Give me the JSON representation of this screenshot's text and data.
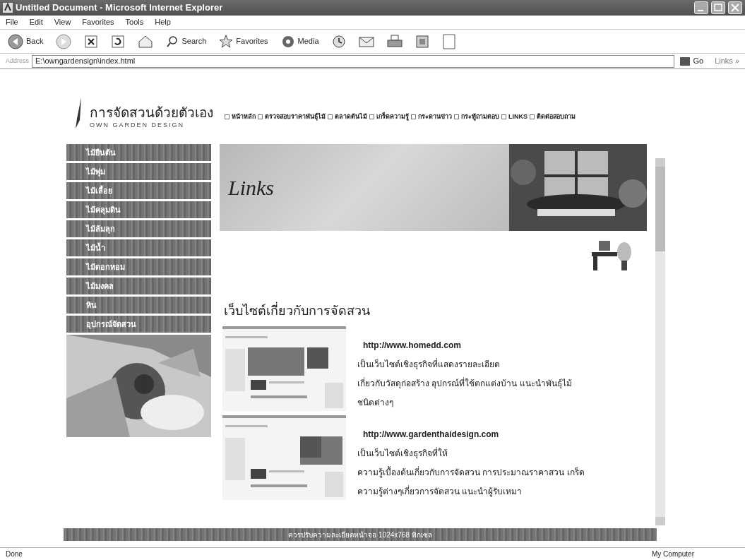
{
  "window": {
    "title": "Untitled Document - Microsoft Internet Explorer"
  },
  "menu": [
    "File",
    "Edit",
    "View",
    "Favorites",
    "Tools",
    "Help"
  ],
  "toolbar": [
    {
      "kind": "back",
      "label": "Back"
    },
    {
      "kind": "forward"
    },
    {
      "kind": "stop"
    },
    {
      "kind": "refresh"
    },
    {
      "kind": "home"
    },
    {
      "kind": "search",
      "label": "Search"
    },
    {
      "kind": "favorites",
      "label": "Favorites"
    },
    {
      "kind": "media",
      "label": "Media"
    },
    {
      "kind": "history"
    },
    {
      "kind": "mail"
    },
    {
      "kind": "print"
    },
    {
      "kind": "edit"
    },
    {
      "kind": "note"
    }
  ],
  "address_bar": {
    "label": "Address",
    "value": "E:\\owngardensign\\index.html",
    "go": "Go",
    "links": "Links »"
  },
  "site": {
    "logo_title": "การจัดสวนด้วยตัวเอง",
    "logo_subtitle": "OWN GARDEN DESIGN",
    "nav": [
      "หน้าหลัก",
      "ตรวจสอบราคาพันธุ์ไม้",
      "ตลาดต้นไม้",
      "เกร็ดความรู้",
      "กระดานข่าว",
      "กระทู้ถามตอบ",
      "LINKS",
      "ติดต่อสอบถาม"
    ],
    "sidebar": [
      "ไม้ยืนต้น",
      "ไม้พุ่ม",
      "ไม้เลื้อย",
      "ไม้คลุมดิน",
      "ไม้ล้มลุก",
      "ไม้น้ำ",
      "ไม้ดอกหอม",
      "ไม้มงคล",
      "หิน",
      "อุปกรณ์จัดสวน"
    ],
    "banner_title": "Links",
    "heading": "เว็บไซต์เกี่ยวกับการจัดสวน",
    "entries": [
      {
        "url": "http://www.homedd.com",
        "lines": [
          "เป็นเว็บไซต์เชิงธุรกิจที่แสดงรายละเอียด",
          "เกี่ยวกับวัสดุก่อสร้าง อุปกรณ์ที่ใช้ตกแต่งบ้าน แนะนำพันธุ์ไม้",
          "ชนิดต่างๆ"
        ]
      },
      {
        "url": "http://www.gardenthaidesign.com",
        "lines": [
          "เป็นเว็บไซต์เชิงธุรกิจที่ให้",
          "ความรู้เบื้องต้นเกี่ยวกับการจัดสวน การประมาณราคาสวน เกร็ด",
          "ความรู้ต่างๆเกี่ยวการจัดสวน แนะนำผู้รับเหมา"
        ]
      }
    ],
    "footer": "ควรปรับความละเอียดหน้าจอ 1024x768 พิกเซล"
  },
  "status_bar": {
    "left": "Done",
    "right": "My Computer"
  }
}
